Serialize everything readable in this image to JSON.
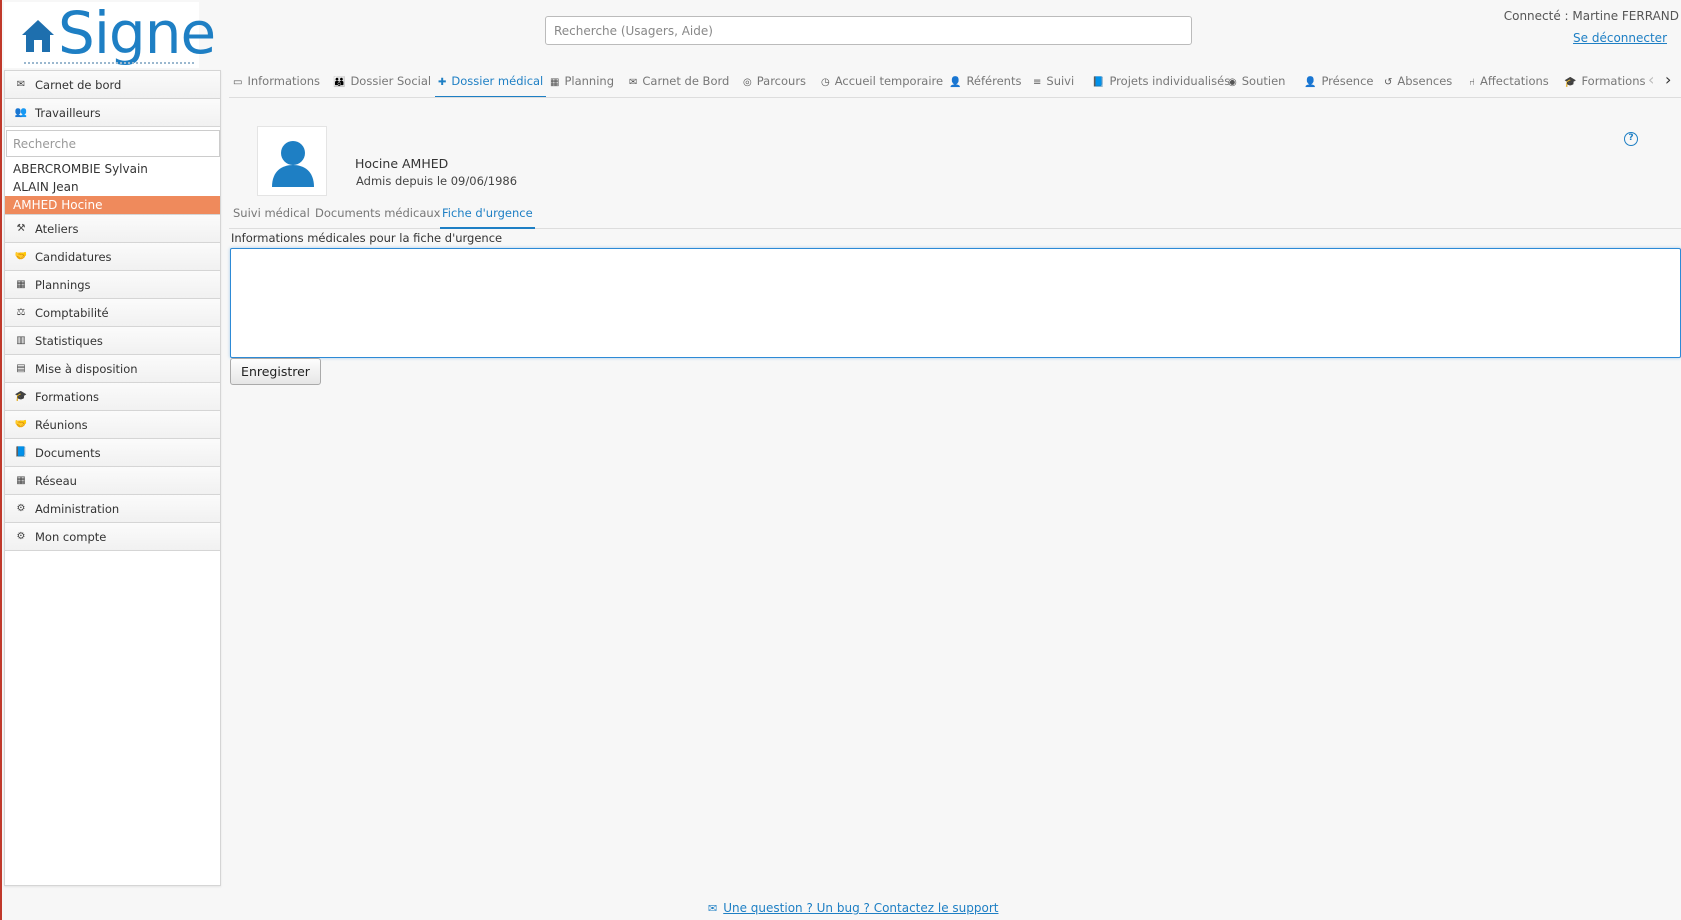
{
  "app": {
    "logo_text": "Signe"
  },
  "header": {
    "search_placeholder": "Recherche (Usagers, Aide)",
    "connected_label": "Connecté : Martine FERRAND",
    "logout_label": "Se déconnecter"
  },
  "sidebar": {
    "top_items": [
      {
        "label": "Carnet de bord",
        "icon": "envelope-icon"
      },
      {
        "label": "Travailleurs",
        "icon": "users-icon"
      }
    ],
    "search_placeholder": "Recherche",
    "workers": [
      "ABERCROMBIE Sylvain",
      "ALAIN Jean",
      "AMHED Hocine"
    ],
    "active_worker": "AMHED Hocine",
    "items": [
      {
        "label": "Ateliers",
        "icon": "worker-icon"
      },
      {
        "label": "Candidatures",
        "icon": "handshake-icon"
      },
      {
        "label": "Plannings",
        "icon": "calendar-icon"
      },
      {
        "label": "Comptabilité",
        "icon": "accounting-icon"
      },
      {
        "label": "Statistiques",
        "icon": "bar-chart-icon"
      },
      {
        "label": "Mise à disposition",
        "icon": "document-icon"
      },
      {
        "label": "Formations",
        "icon": "graduation-cap-icon"
      },
      {
        "label": "Réunions",
        "icon": "handshake-icon"
      },
      {
        "label": "Documents",
        "icon": "book-icon"
      },
      {
        "label": "Réseau",
        "icon": "building-icon"
      },
      {
        "label": "Administration",
        "icon": "cogs-icon"
      },
      {
        "label": "Mon compte",
        "icon": "gear-icon"
      }
    ]
  },
  "tabs": [
    {
      "label": "Informations",
      "icon": "id-card-icon"
    },
    {
      "label": "Dossier Social",
      "icon": "family-icon"
    },
    {
      "label": "Dossier médical",
      "icon": "medkit-icon",
      "active": true
    },
    {
      "label": "Planning",
      "icon": "calendar-icon"
    },
    {
      "label": "Carnet de Bord",
      "icon": "envelope-icon"
    },
    {
      "label": "Parcours",
      "icon": "compass-icon"
    },
    {
      "label": "Accueil temporaire",
      "icon": "clock-icon"
    },
    {
      "label": "Référents",
      "icon": "user-icon"
    },
    {
      "label": "Suivi",
      "icon": "steps-icon"
    },
    {
      "label": "Projets individualisés",
      "icon": "book-icon"
    },
    {
      "label": "Soutien",
      "icon": "lifebuoy-icon"
    },
    {
      "label": "Présence",
      "icon": "user-check-icon"
    },
    {
      "label": "Absences",
      "icon": "history-icon"
    },
    {
      "label": "Affectations",
      "icon": "chair-icon"
    },
    {
      "label": "Formations",
      "icon": "graduation-cap-icon"
    }
  ],
  "person": {
    "name": "Hocine AMHED",
    "admitted": "Admis depuis le 09/06/1986"
  },
  "subtabs": [
    {
      "label": "Suivi médical"
    },
    {
      "label": "Documents médicaux"
    },
    {
      "label": "Fiche d'urgence",
      "active": true
    }
  ],
  "form": {
    "field_label": "Informations médicales pour la fiche d'urgence",
    "field_value": "",
    "save_label": "Enregistrer"
  },
  "footer": {
    "support_label": "Une question ? Un bug ? Contactez le support"
  },
  "colors": {
    "accent": "#1e7fc4",
    "active_worker_bg": "#ef8a5c"
  }
}
